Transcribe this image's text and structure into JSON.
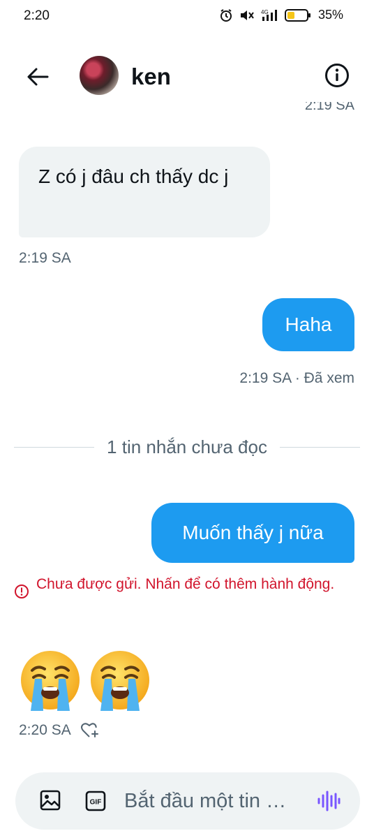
{
  "status_bar": {
    "time": "2:20",
    "network": "4G",
    "battery": "35%",
    "icons": [
      "alarm-icon",
      "mute-icon",
      "signal-icon",
      "battery-icon"
    ]
  },
  "header": {
    "contact_name": "ken",
    "back_icon": "arrow-left-icon",
    "info_icon": "info-icon"
  },
  "messages": {
    "clipped_timestamp": "2:19 SA",
    "incoming_1": {
      "text": "Z có j đâu ch thấy dc j",
      "timestamp": "2:19 SA"
    },
    "outgoing_1": {
      "text": "Haha",
      "timestamp": "2:19 SA · Đã xem"
    },
    "unread_divider": "1 tin nhắn chưa đọc",
    "outgoing_2": {
      "text": "Muốn thấy j nữa"
    },
    "send_error": "Chưa được gửi. Nhấn để có thêm hành động.",
    "incoming_2": {
      "emojis": [
        "loudly-crying-face",
        "loudly-crying-face"
      ],
      "timestamp": "2:20 SA"
    }
  },
  "composer": {
    "placeholder": "Bắt đầu một tin …",
    "gif_label": "GIF"
  },
  "colors": {
    "accent": "#1d9bf0",
    "incoming_bubble": "#eff3f4",
    "error": "#d1142c",
    "voice_icon": "#7856ff"
  }
}
